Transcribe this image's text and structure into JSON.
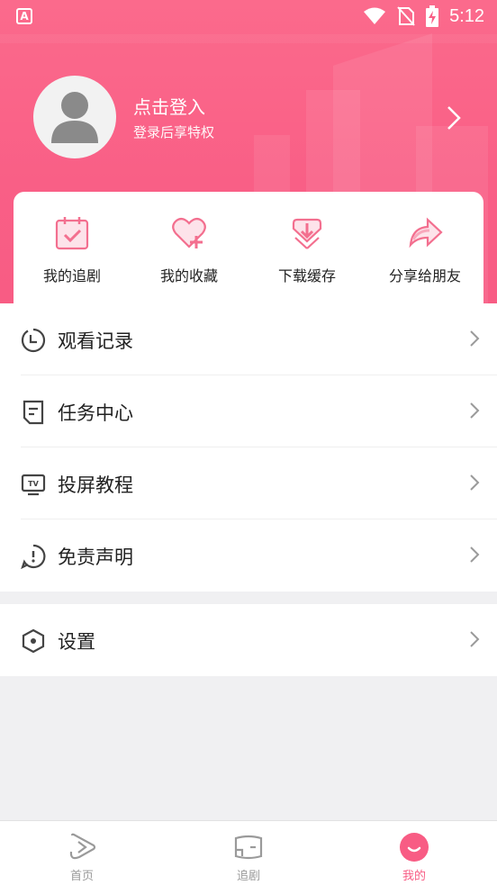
{
  "status_bar": {
    "time": "5:12",
    "app_icon_letter": "A"
  },
  "profile": {
    "login_title": "点击登入",
    "login_subtitle": "登录后享特权"
  },
  "quick_actions": [
    {
      "label": "我的追剧",
      "icon": "calendar-check-icon"
    },
    {
      "label": "我的收藏",
      "icon": "heart-plus-icon"
    },
    {
      "label": "下载缓存",
      "icon": "download-box-icon"
    },
    {
      "label": "分享给朋友",
      "icon": "share-arrow-icon"
    }
  ],
  "menu": [
    {
      "label": "观看记录",
      "icon": "clock-icon"
    },
    {
      "label": "任务中心",
      "icon": "task-doc-icon"
    },
    {
      "label": "投屏教程",
      "icon": "tv-icon"
    },
    {
      "label": "免责声明",
      "icon": "alert-bubble-icon"
    }
  ],
  "settings": {
    "label": "设置",
    "icon": "settings-hexagon-icon"
  },
  "bottom_nav": [
    {
      "label": "首页",
      "icon": "play-home-icon",
      "active": false
    },
    {
      "label": "追剧",
      "icon": "tv-follow-icon",
      "active": false
    },
    {
      "label": "我的",
      "icon": "smile-profile-icon",
      "active": true
    }
  ],
  "colors": {
    "accent": "#f85c84",
    "accent_light": "#fb6a8c",
    "text": "#222222",
    "muted": "#9a9a9a",
    "page_bg": "#f0f0f2"
  }
}
